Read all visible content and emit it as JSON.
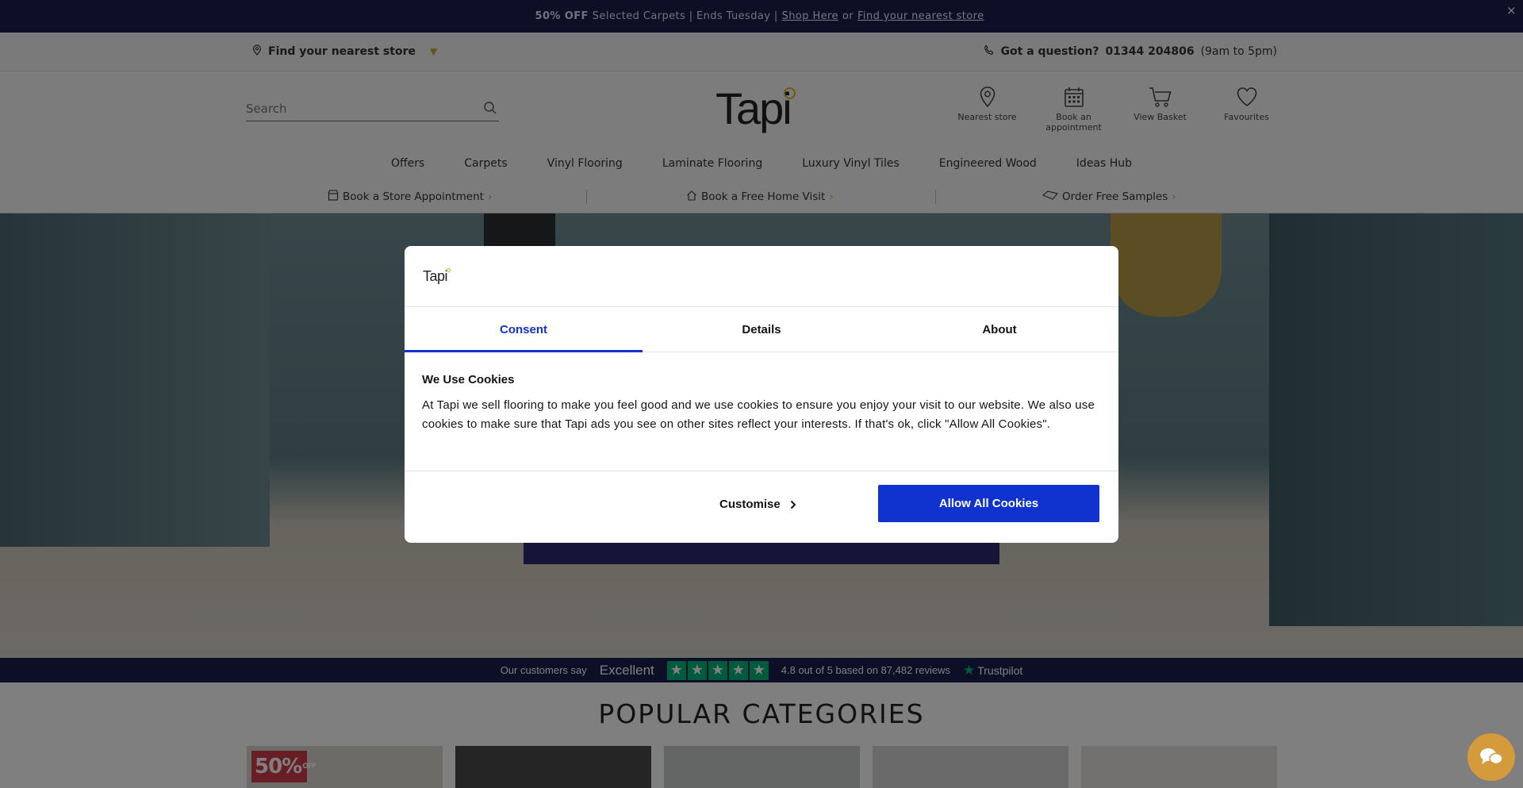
{
  "promo": {
    "bold": "50% OFF",
    "text": "Selected Carpets | Ends Tuesday |",
    "link1": "Shop Here",
    "or": "or",
    "link2": "Find your nearest store",
    "close": "×"
  },
  "utility": {
    "store": "Find your nearest store",
    "question": "Got a question?",
    "phone": "01344 204806",
    "hours": "(9am to 5pm)"
  },
  "header": {
    "search_placeholder": "Search",
    "logo": "Tapi",
    "icons": [
      {
        "label": "Nearest store",
        "icon": "map-pin-icon"
      },
      {
        "label": "Book an appointment",
        "icon": "calendar-icon"
      },
      {
        "label": "View Basket",
        "icon": "basket-icon"
      },
      {
        "label": "Favourites",
        "icon": "heart-icon"
      }
    ]
  },
  "nav": [
    "Offers",
    "Carpets",
    "Vinyl Flooring",
    "Laminate Flooring",
    "Luxury Vinyl Tiles",
    "Engineered Wood",
    "Ideas Hub"
  ],
  "subnav": {
    "store_appt": "Book a Store Appointment",
    "home_visit": "Book a Free Home Visit",
    "samples": "Order Free Samples",
    "arrow": "›"
  },
  "trustpilot": {
    "say": "Our customers say",
    "rating_word": "Excellent",
    "summary": "4.8 out of 5 based on 87,482 reviews",
    "brand": "Trustpilot",
    "stars": 5
  },
  "categories": {
    "title": "POPULAR CATEGORIES",
    "badge": "50%",
    "badge_small": "OFF"
  },
  "cookie": {
    "logo": "Tapi",
    "tabs": [
      "Consent",
      "Details",
      "About"
    ],
    "active_tab": "Consent",
    "heading": "We Use Cookies",
    "body": "At Tapi we sell flooring to make you feel good and we use cookies to ensure you enjoy your visit to our website. We also use cookies to make sure that Tapi ads you see on other sites reflect your interests. If that's ok, click \"Allow All Cookies\".",
    "customise": "Customise",
    "allow": "Allow All Cookies"
  },
  "colors": {
    "navy": "#1a1f4e",
    "gold": "#d8a93b",
    "cookie_blue": "#1032cf",
    "trustpilot_green": "#00b67a",
    "chat_orange": "#d49a3c"
  }
}
